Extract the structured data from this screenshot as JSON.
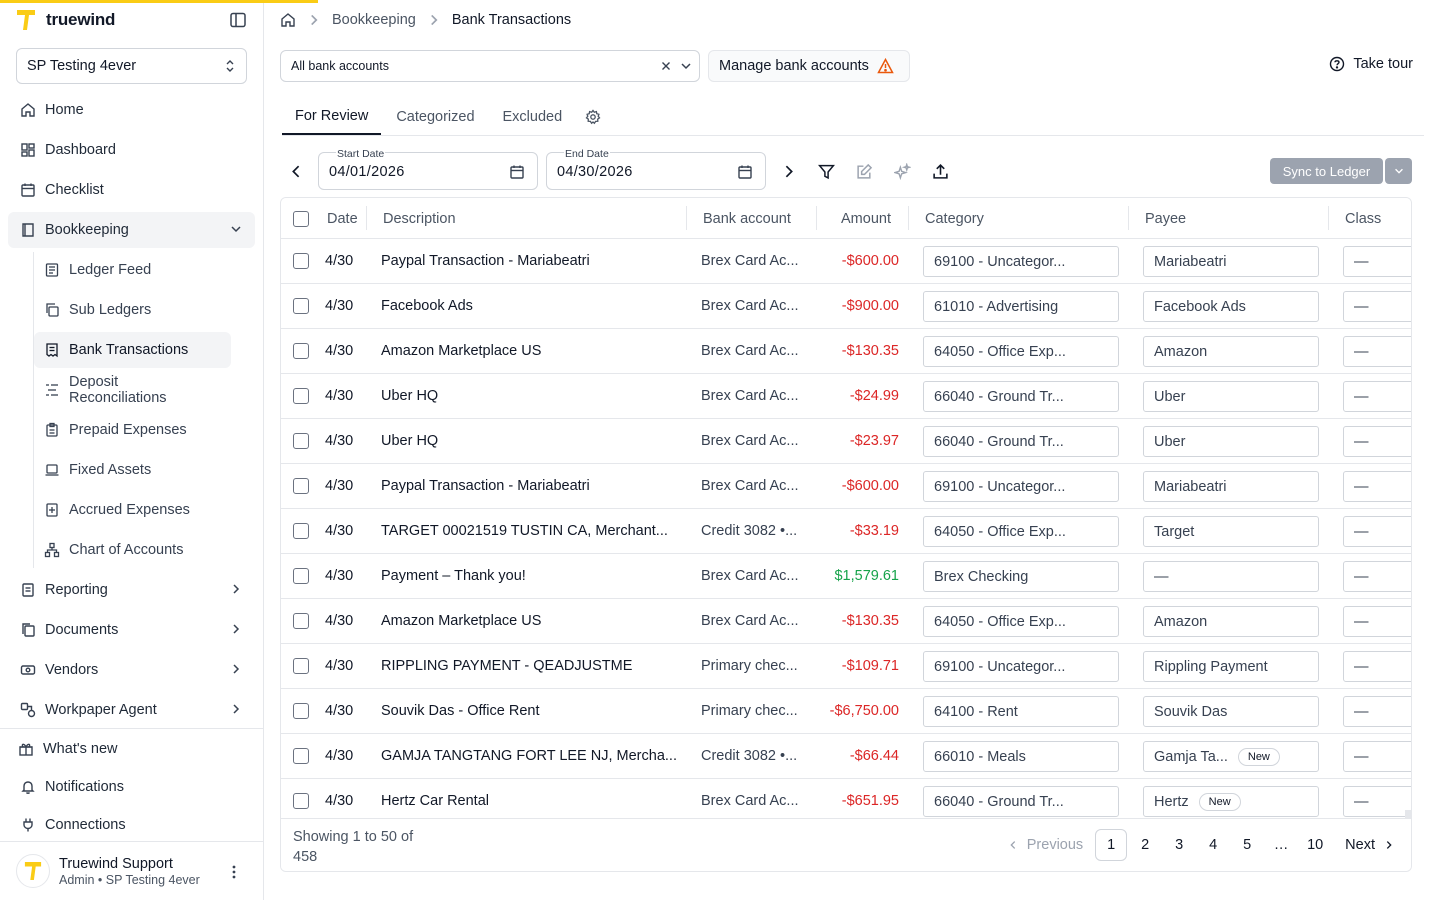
{
  "brand": {
    "name": "truewind",
    "accent": "#facc15"
  },
  "org": {
    "name": "SP Testing 4ever"
  },
  "nav": [
    {
      "label": "Home",
      "icon": "home-icon"
    },
    {
      "label": "Dashboard",
      "icon": "dashboard-icon"
    },
    {
      "label": "Checklist",
      "icon": "calendar-icon"
    },
    {
      "label": "Bookkeeping",
      "icon": "book-icon",
      "open": true
    }
  ],
  "subnav": [
    {
      "label": "Ledger Feed",
      "icon": "ledger-icon"
    },
    {
      "label": "Sub Ledgers",
      "icon": "copy-icon"
    },
    {
      "label": "Bank Transactions",
      "icon": "receipt-icon",
      "active": true
    },
    {
      "label": "Deposit Reconciliations",
      "icon": "list-icon"
    },
    {
      "label": "Prepaid Expenses",
      "icon": "clipboard-icon"
    },
    {
      "label": "Fixed Assets",
      "icon": "laptop-icon"
    },
    {
      "label": "Accrued Expenses",
      "icon": "plus-doc-icon"
    },
    {
      "label": "Chart of Accounts",
      "icon": "hierarchy-icon"
    }
  ],
  "nav2": [
    {
      "label": "Reporting",
      "icon": "report-icon"
    },
    {
      "label": "Documents",
      "icon": "documents-icon"
    },
    {
      "label": "Vendors",
      "icon": "vendor-icon"
    },
    {
      "label": "Workpaper Agent",
      "icon": "agent-icon"
    }
  ],
  "nav_bottom": [
    {
      "label": "What's new",
      "icon": "gift-icon"
    },
    {
      "label": "Notifications",
      "icon": "bell-icon"
    },
    {
      "label": "Connections",
      "icon": "plug-icon"
    }
  ],
  "user": {
    "name": "Truewind Support",
    "role": "Admin • SP Testing 4ever"
  },
  "breadcrumb": {
    "section": "Bookkeeping",
    "current": "Bank Transactions"
  },
  "accounts": {
    "selected": "All bank accounts",
    "manage_label": "Manage bank accounts",
    "tour_label": "Take tour"
  },
  "tabs": [
    "For Review",
    "Categorized",
    "Excluded"
  ],
  "filters": {
    "start_label": "Start Date",
    "start": "04/01/2026",
    "end_label": "End Date",
    "end": "04/30/2026",
    "sync_label": "Sync to Ledger"
  },
  "columns": [
    "Date",
    "Description",
    "Bank account",
    "Amount",
    "Category",
    "Payee",
    "Class"
  ],
  "rows": [
    {
      "date": "4/30",
      "desc": "Paypal Transaction - Mariabeatri",
      "bank": "Brex Card Ac...",
      "amount": "-$600.00",
      "sign": "neg",
      "category": "69100 - Uncategor...",
      "payee": "Mariabeatri",
      "payee_new": "",
      "class": "—"
    },
    {
      "date": "4/30",
      "desc": "Facebook Ads",
      "bank": "Brex Card Ac...",
      "amount": "-$900.00",
      "sign": "neg",
      "category": "61010 - Advertising",
      "payee": "Facebook Ads",
      "payee_new": "",
      "class": "—"
    },
    {
      "date": "4/30",
      "desc": "Amazon Marketplace US",
      "bank": "Brex Card Ac...",
      "amount": "-$130.35",
      "sign": "neg",
      "category": "64050 - Office Exp...",
      "payee": "Amazon",
      "payee_new": "",
      "class": "—"
    },
    {
      "date": "4/30",
      "desc": "Uber HQ",
      "bank": "Brex Card Ac...",
      "amount": "-$24.99",
      "sign": "neg",
      "category": "66040 - Ground Tr...",
      "payee": "Uber",
      "payee_new": "",
      "class": "—"
    },
    {
      "date": "4/30",
      "desc": "Uber HQ",
      "bank": "Brex Card Ac...",
      "amount": "-$23.97",
      "sign": "neg",
      "category": "66040 - Ground Tr...",
      "payee": "Uber",
      "payee_new": "",
      "class": "—"
    },
    {
      "date": "4/30",
      "desc": "Paypal Transaction - Mariabeatri",
      "bank": "Brex Card Ac...",
      "amount": "-$600.00",
      "sign": "neg",
      "category": "69100 - Uncategor...",
      "payee": "Mariabeatri",
      "payee_new": "",
      "class": "—"
    },
    {
      "date": "4/30",
      "desc": "TARGET 00021519 TUSTIN CA, Merchant...",
      "bank": "Credit 3082 •...",
      "amount": "-$33.19",
      "sign": "neg",
      "category": "64050 - Office Exp...",
      "payee": "Target",
      "payee_new": "",
      "class": "—"
    },
    {
      "date": "4/30",
      "desc": "Payment – Thank you!",
      "bank": "Brex Card Ac...",
      "amount": "$1,579.61",
      "sign": "pos",
      "category": "Brex Checking",
      "payee": "—",
      "payee_new": "",
      "class": "—"
    },
    {
      "date": "4/30",
      "desc": "Amazon Marketplace US",
      "bank": "Brex Card Ac...",
      "amount": "-$130.35",
      "sign": "neg",
      "category": "64050 - Office Exp...",
      "payee": "Amazon",
      "payee_new": "",
      "class": "—"
    },
    {
      "date": "4/30",
      "desc": "RIPPLING PAYMENT - QEADJUSTME",
      "bank": "Primary chec...",
      "amount": "-$109.71",
      "sign": "neg",
      "category": "69100 - Uncategor...",
      "payee": "Rippling Payment",
      "payee_new": "",
      "class": "—"
    },
    {
      "date": "4/30",
      "desc": "Souvik Das - Office Rent",
      "bank": "Primary chec...",
      "amount": "-$6,750.00",
      "sign": "neg",
      "category": "64100 - Rent",
      "payee": "Souvik Das",
      "payee_new": "",
      "class": "—"
    },
    {
      "date": "4/30",
      "desc": "GAMJA TANGTANG FORT LEE NJ, Mercha...",
      "bank": "Credit 3082 •...",
      "amount": "-$66.44",
      "sign": "neg",
      "category": "66010 - Meals",
      "payee": "Gamja Ta...",
      "payee_new": "New",
      "class": "—"
    },
    {
      "date": "4/30",
      "desc": "Hertz Car Rental",
      "bank": "Brex Card Ac...",
      "amount": "-$651.95",
      "sign": "neg",
      "category": "66040 - Ground Tr...",
      "payee": "Hertz",
      "payee_new": "New",
      "class": "—"
    }
  ],
  "pagination": {
    "showing_line1": "Showing 1 to 50 of",
    "showing_line2": "458",
    "prev": "Previous",
    "next": "Next",
    "pages": [
      "1",
      "2",
      "3",
      "4",
      "5",
      "…",
      "10"
    ],
    "current": "1"
  },
  "colors": {
    "negative": "#dc2626",
    "positive": "#16a34a",
    "sync_bg": "#9ca3af",
    "warning": "#ea580c"
  }
}
